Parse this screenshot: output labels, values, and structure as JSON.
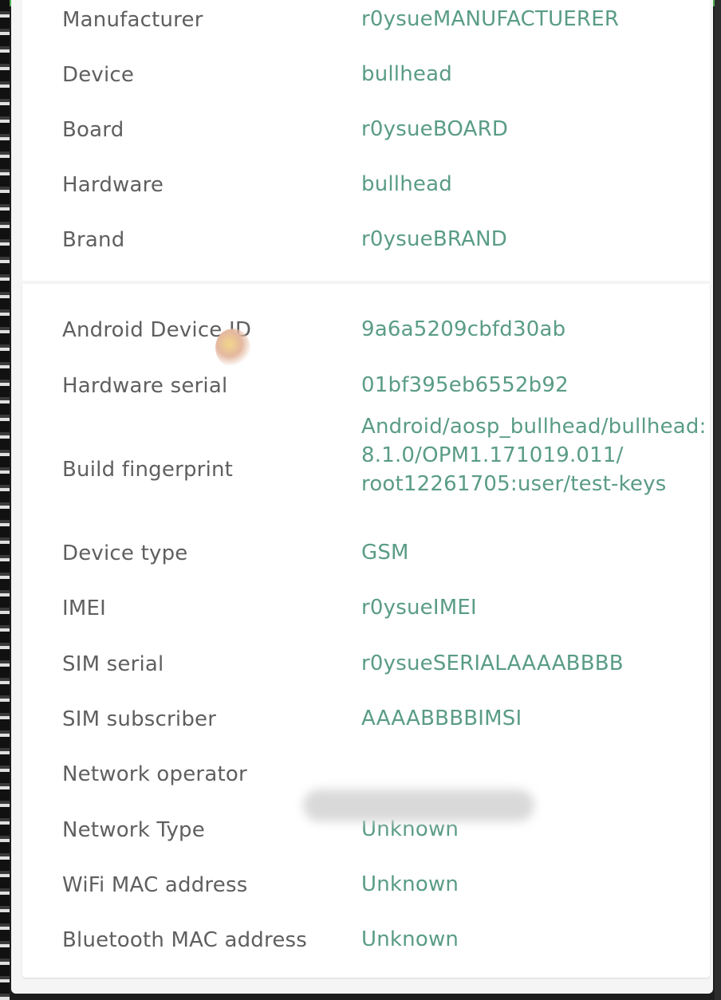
{
  "device_info": [
    {
      "label": "Manufacturer",
      "value": "r0ysueMANUFACTUERER"
    },
    {
      "label": "Device",
      "value": "bullhead"
    },
    {
      "label": "Board",
      "value": "r0ysueBOARD"
    },
    {
      "label": "Hardware",
      "value": "bullhead"
    },
    {
      "label": "Brand",
      "value": "r0ysueBRAND"
    }
  ],
  "ids_info": [
    {
      "label": "Android Device ID",
      "value": "9a6a5209cbfd30ab"
    },
    {
      "label": "Hardware serial",
      "value": "01bf395eb6552b92"
    },
    {
      "label": "Build fingerprint",
      "value_lines": [
        "Android/aosp_bullhead/bullhead:",
        "8.1.0/OPM1.171019.011/",
        "root12261705:user/test-keys"
      ]
    },
    {
      "label": "Device type",
      "value": "GSM"
    },
    {
      "label": "IMEI",
      "value": "r0ysueIMEI"
    },
    {
      "label": "SIM serial",
      "value": "r0ysueSERIALAAAABBBB"
    },
    {
      "label": "SIM subscriber",
      "value": "AAAABBBBIMSI"
    },
    {
      "label": "Network operator",
      "value": ""
    },
    {
      "label": "Network Type",
      "value": "Unknown"
    },
    {
      "label": "WiFi MAC address",
      "value": "Unknown"
    },
    {
      "label": "Bluetooth MAC address",
      "value": "Unknown"
    }
  ],
  "colors": {
    "label": "#5f5f5f",
    "value": "#5a9c86",
    "accent": "#4caf50",
    "card_bg": "#ffffff"
  }
}
